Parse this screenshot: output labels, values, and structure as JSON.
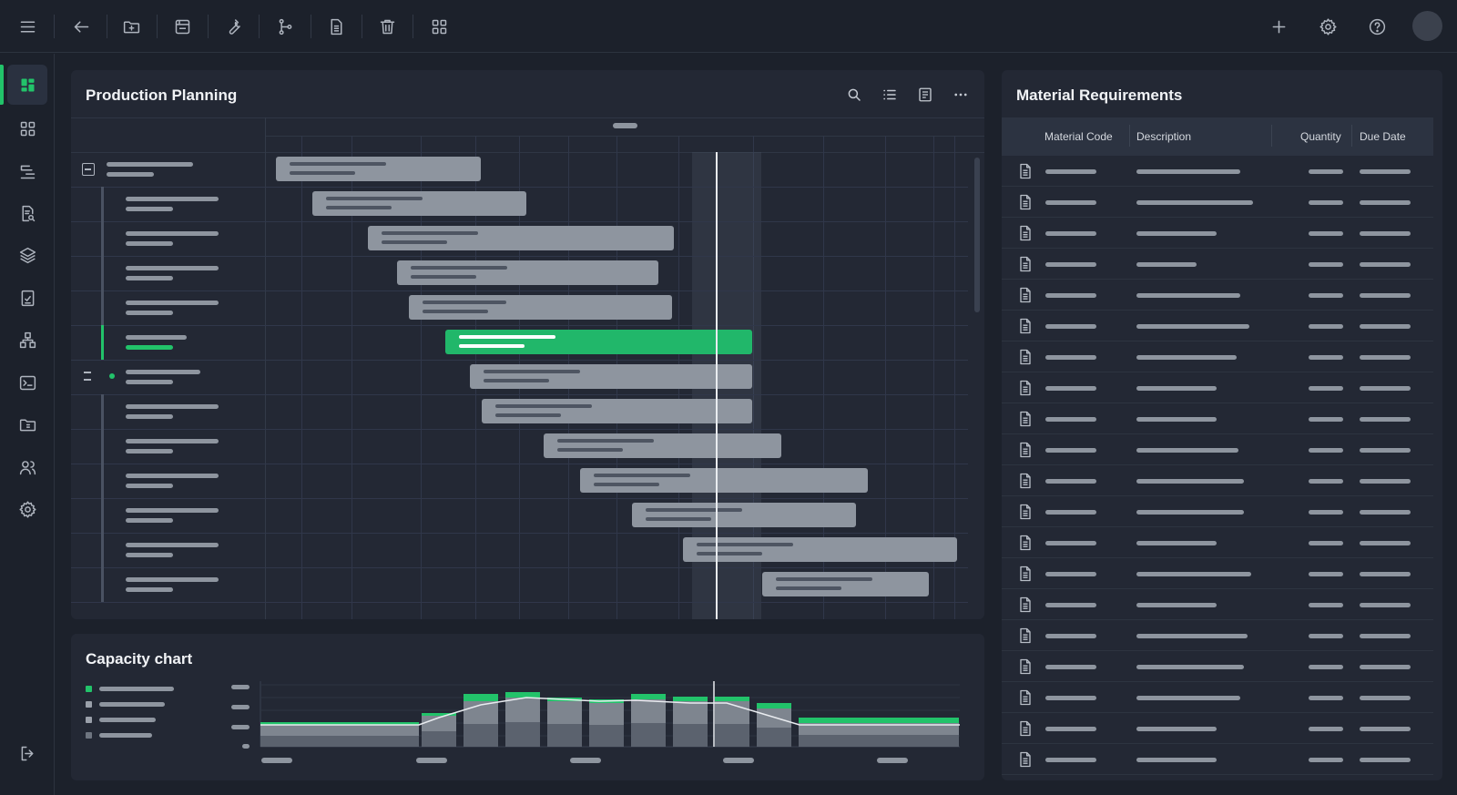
{
  "toolbar": {
    "left_icons": [
      "menu-icon",
      "arrow-left-icon",
      "folder-plus-icon",
      "save-icon",
      "wrench-icon",
      "git-branch-icon",
      "document-icon",
      "trash-icon",
      "grid-icon"
    ],
    "right_icons": [
      "plus-icon",
      "gear-icon",
      "help-icon"
    ]
  },
  "sidebar": {
    "items": [
      "dashboard-icon",
      "grid-icon",
      "filter-list-icon",
      "document-search-icon",
      "layers-icon",
      "checklist-icon",
      "hierarchy-icon",
      "terminal-icon",
      "folder-icon",
      "users-icon",
      "gear-icon"
    ],
    "active": 0,
    "logout_icon": "logout-icon"
  },
  "planning": {
    "title": "Production Planning",
    "header_icons": [
      "search-icon",
      "list-icon",
      "notes-icon",
      "more-icon"
    ]
  },
  "materials": {
    "title": "Material Requirements",
    "columns": [
      "Material Code",
      "Description",
      "Quantity",
      "Due Date"
    ]
  },
  "capacity": {
    "title": "Capacity chart"
  },
  "colors": {
    "accent": "#22c36a",
    "background": "#1c212b",
    "panel": "#232834",
    "bar": "#8e959f"
  }
}
